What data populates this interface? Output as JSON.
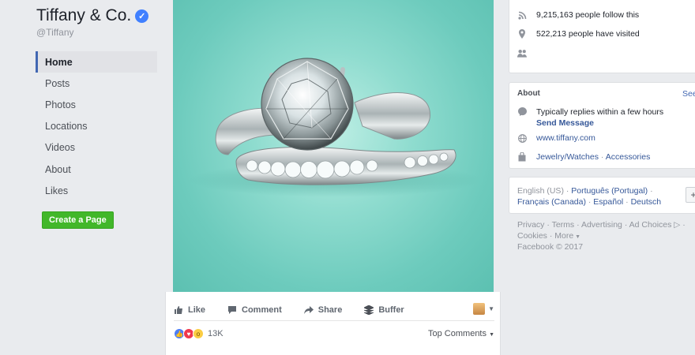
{
  "page": {
    "name": "Tiffany & Co.",
    "handle": "@Tiffany"
  },
  "nav": {
    "items": [
      {
        "label": "Home"
      },
      {
        "label": "Posts"
      },
      {
        "label": "Photos"
      },
      {
        "label": "Locations"
      },
      {
        "label": "Videos"
      },
      {
        "label": "About"
      },
      {
        "label": "Likes"
      }
    ],
    "create_page": "Create a Page"
  },
  "post": {
    "actions": {
      "like": "Like",
      "comment": "Comment",
      "share": "Share",
      "buffer": "Buffer"
    },
    "reaction_count": "13K",
    "top_comments": "Top Comments"
  },
  "stats": {
    "followers": "9,215,163 people follow this",
    "visits": "522,213 people have visited"
  },
  "about": {
    "title": "About",
    "see_all": "See",
    "replies": "Typically replies within a few hours",
    "send_message": "Send Message",
    "website": "www.tiffany.com",
    "category1": "Jewelry/Watches",
    "sep": " · ",
    "category2": "Accessories"
  },
  "languages": {
    "current": "English (US)",
    "sep": " · ",
    "portugues": "Português (Portugal)",
    "francais": "Français (Canada)",
    "espanol": "Español",
    "deutsch": "Deutsch",
    "plus": "+"
  },
  "footer": {
    "privacy": "Privacy",
    "terms": "Terms",
    "advertising": "Advertising",
    "ad_choices": "Ad Choices",
    "cookies": "Cookies",
    "more": "More",
    "copyright": "Facebook © 2017",
    "sep": " · "
  },
  "colors": {
    "accent": "#4267b2",
    "create_green": "#42b72a",
    "bg": "#e9ebee",
    "teal": "#81d8d0"
  }
}
